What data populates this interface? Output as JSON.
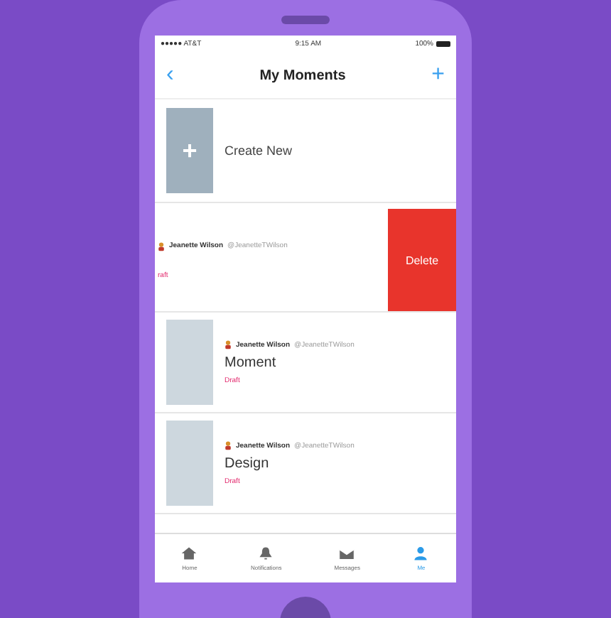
{
  "status_bar": {
    "carrier": "●●●●● AT&T",
    "time": "9:15 AM",
    "battery": "100%"
  },
  "nav": {
    "back": "‹",
    "title": "My Moments",
    "add": "+"
  },
  "create": {
    "label": "Create New",
    "plus": "+"
  },
  "moments": [
    {
      "name": "Jeanette Wilson",
      "handle": "@JeanetteTWilson",
      "status": "raft",
      "swiped": true,
      "action": "Delete"
    },
    {
      "name": "Jeanette Wilson",
      "handle": "@JeanetteTWilson",
      "title": "Moment",
      "status": "Draft",
      "swiped": false
    },
    {
      "name": "Jeanette Wilson",
      "handle": "@JeanetteTWilson",
      "title": "Design",
      "status": "Draft",
      "swiped": false
    }
  ],
  "tabs": [
    {
      "label": "Home",
      "kind": "home",
      "selected": false
    },
    {
      "label": "Notifications",
      "kind": "bell",
      "selected": false
    },
    {
      "label": "Messages",
      "kind": "mail",
      "selected": false
    },
    {
      "label": "Me",
      "kind": "person",
      "selected": true
    }
  ]
}
